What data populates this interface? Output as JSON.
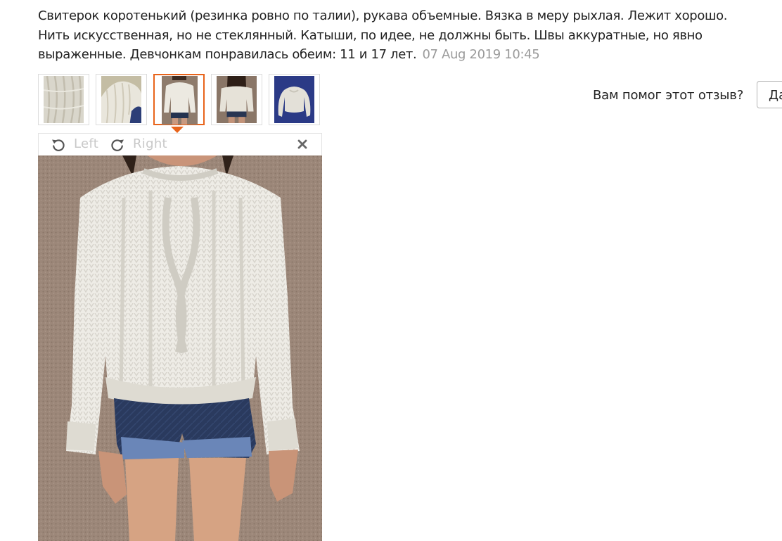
{
  "review": {
    "lines": [
      "Свитерок коротенький (резинка ровно по талии), рукава объемные. Вязка в меру рыхлая. Лежит хорошо.",
      "Нить искусственная, но не стеклянный. Катыши, по идее, не должны быть. Швы аккуратные, но явно",
      "выраженные. Девчонкам понравилась обеим: 11 и 17 лет."
    ],
    "date": "07 Aug 2019 10:45"
  },
  "viewer": {
    "rotate_left_label": "Left",
    "rotate_right_label": "Right",
    "close_icon": "close-icon"
  },
  "helpful": {
    "question": "Вам помог этот отзыв?",
    "yes_label": "Да"
  },
  "thumbnails": {
    "count": 5,
    "active_index": 2
  },
  "colors": {
    "accent": "#e8641b",
    "muted_text": "#9a9a9a",
    "toolbar_text": "#c8c8c8"
  }
}
